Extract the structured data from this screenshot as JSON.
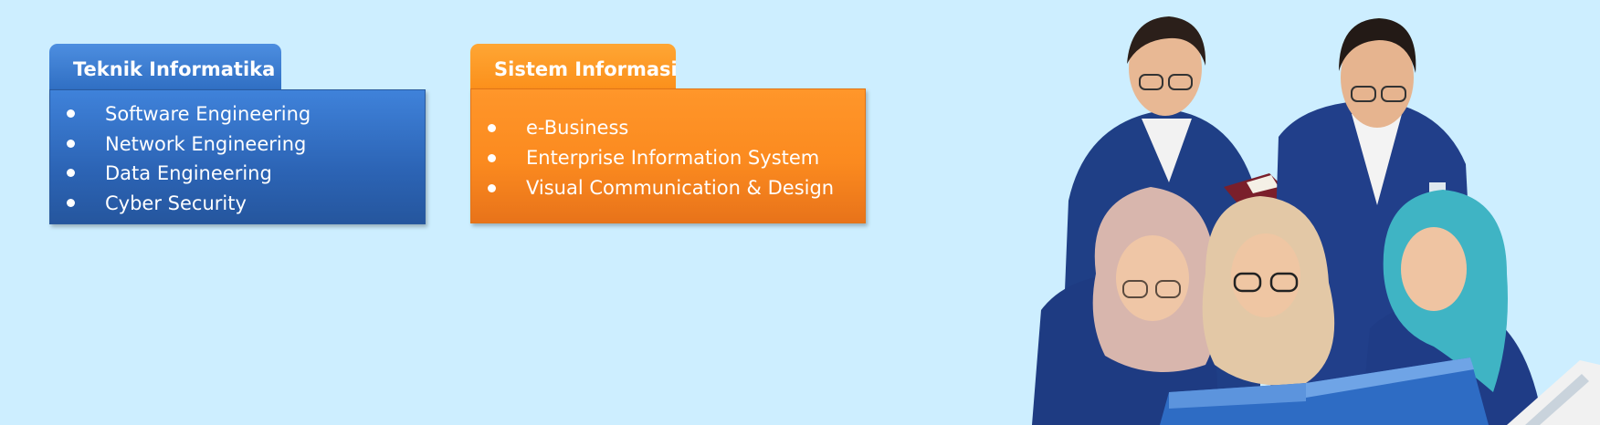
{
  "cards": [
    {
      "title": "Teknik Informatika",
      "items": [
        "Software Engineering",
        "Network Engineering",
        "Data Engineering",
        "Cyber Security"
      ],
      "color": "#2f6ec2"
    },
    {
      "title": "Sistem Informasi",
      "items": [
        "e-Business",
        "Enterprise Information System",
        "Visual Communication & Design"
      ],
      "color": "#fb8f1a"
    }
  ],
  "photo": {
    "icon": "students-group-photo",
    "jacket_color": "#1f3f86",
    "background_color": "#cdeeff"
  }
}
